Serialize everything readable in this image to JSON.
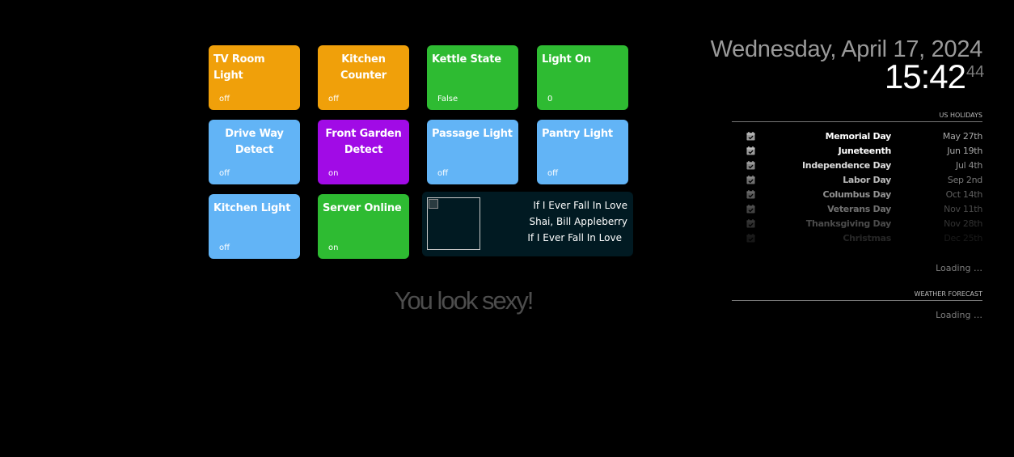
{
  "tiles": [
    {
      "title": "TV Room Light",
      "state": "off",
      "color": "#f0a00a"
    },
    {
      "title": "Kitchen Counter",
      "state": "off",
      "color": "#f0a00a"
    },
    {
      "title": "Kettle State",
      "state": "False",
      "color": "#2ebb32"
    },
    {
      "title": "Light On",
      "state": "0",
      "color": "#2ebb32"
    },
    {
      "title": "Drive Way Detect",
      "state": "off",
      "color": "#62b4f6"
    },
    {
      "title": "Front Garden Detect",
      "state": "on",
      "color": "#a10be6"
    },
    {
      "title": "Passage Light",
      "state": "off",
      "color": "#62b4f6"
    },
    {
      "title": "Pantry Light",
      "state": "off",
      "color": "#62b4f6"
    },
    {
      "title": "Kitchen Light",
      "state": "off",
      "color": "#62b4f6"
    },
    {
      "title": "Server Online",
      "state": "on",
      "color": "#2ebb32"
    }
  ],
  "media": {
    "title": "If I Ever Fall In Love",
    "artist": "Shai, Bill Appleberry",
    "album": "If I Ever Fall In Love"
  },
  "compliment": "You look sexy!",
  "clock": {
    "date": "Wednesday, April 17, 2024",
    "time": "15:42",
    "seconds": "44"
  },
  "holidays": {
    "header": "US HOLIDAYS",
    "icon": "calendar-check-icon",
    "items": [
      {
        "name": "Memorial Day",
        "date": "May 27th"
      },
      {
        "name": "Juneteenth",
        "date": "Jun 19th"
      },
      {
        "name": "Independence Day",
        "date": "Jul 4th"
      },
      {
        "name": "Labor Day",
        "date": "Sep 2nd"
      },
      {
        "name": "Columbus Day",
        "date": "Oct 14th"
      },
      {
        "name": "Veterans Day",
        "date": "Nov 11th"
      },
      {
        "name": "Thanksgiving Day",
        "date": "Nov 28th"
      },
      {
        "name": "Christmas",
        "date": "Dec 25th"
      }
    ],
    "loading": "Loading …"
  },
  "weather": {
    "header": "WEATHER FORECAST",
    "loading": "Loading …"
  }
}
